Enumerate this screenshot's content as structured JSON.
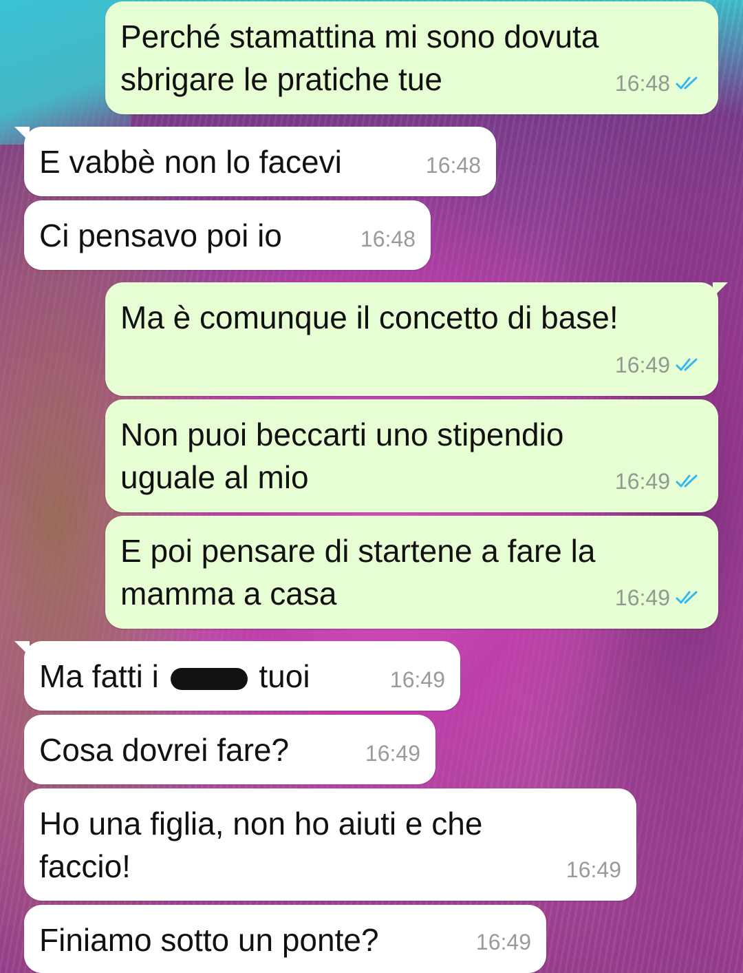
{
  "colors": {
    "outgoing_bubble": "#e7fed4",
    "incoming_bubble": "#ffffff",
    "read_ticks": "#34b7f1",
    "timestamp": "#8f9a91"
  },
  "messages": [
    {
      "id": "m1",
      "direction": "outgoing",
      "text": "Perché stamattina mi sono dovuta\nsbrigare le pratiche tue",
      "time": "16:48",
      "status": "read-double-check-icon"
    },
    {
      "id": "m2",
      "direction": "incoming",
      "text": "E vabbè non lo facevi",
      "time": "16:48"
    },
    {
      "id": "m3",
      "direction": "incoming",
      "text": "Ci pensavo poi io",
      "time": "16:48"
    },
    {
      "id": "m4",
      "direction": "outgoing",
      "text": "Ma è comunque il concetto di base!",
      "time": "16:49",
      "status": "read-double-check-icon"
    },
    {
      "id": "m5",
      "direction": "outgoing",
      "text": "Non puoi beccarti uno stipendio\nuguale al mio",
      "time": "16:49",
      "status": "read-double-check-icon"
    },
    {
      "id": "m6",
      "direction": "outgoing",
      "text": "E poi pensare di startene a fare la\nmamma a casa",
      "time": "16:49",
      "status": "read-double-check-icon"
    },
    {
      "id": "m7",
      "direction": "incoming",
      "text_before": "Ma fatti i",
      "text_after": "tuoi",
      "time": "16:49"
    },
    {
      "id": "m8",
      "direction": "incoming",
      "text": "Cosa dovrei fare?",
      "time": "16:49"
    },
    {
      "id": "m9",
      "direction": "incoming",
      "text": "Ho una figlia, non ho aiuti e che\nfaccio!",
      "time": "16:49"
    },
    {
      "id": "m10",
      "direction": "incoming",
      "text": "Finiamo sotto un ponte?",
      "time": "16:49"
    }
  ]
}
